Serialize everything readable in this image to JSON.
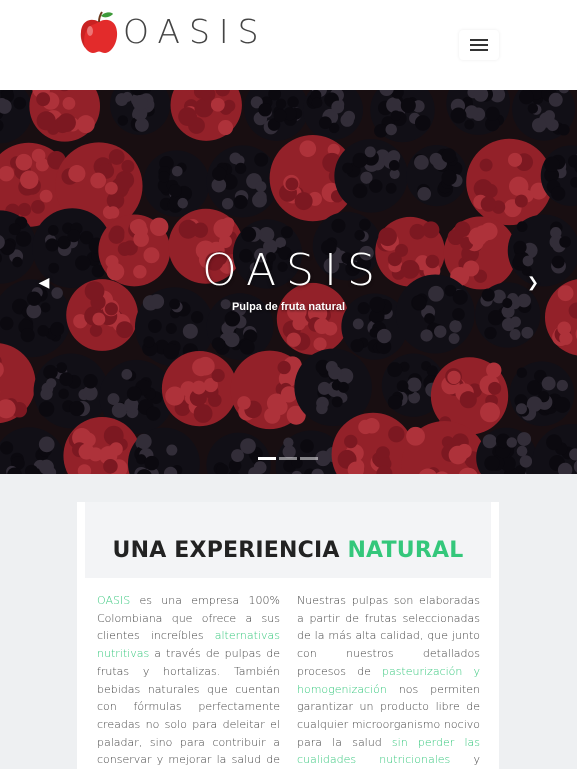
{
  "header": {
    "brand": "OASIS",
    "menu_icon": "hamburger-menu-icon"
  },
  "hero": {
    "title": "OASIS",
    "subtitle": "Pulpa de fruta natural",
    "prev_icon": "chevron-left-icon",
    "next_icon": "chevron-right-icon",
    "slides": 3,
    "active_slide": 1
  },
  "section": {
    "title_main": "UNA EXPERIENCIA ",
    "title_accent": "NATURAL",
    "col1": {
      "p1": "OASIS",
      "p2": " es una empresa 100% Colombiana que ofrece a sus clientes increíbles ",
      "p3": "alternativas nutritivas",
      "p4": " a través de pulpas de frutas y hortalizas. También bebidas naturales que cuentan con fórmulas perfectamente creadas no solo para deleitar el paladar, sino para contribuir a conservar y mejorar la salud de los consumidores."
    },
    "col2": {
      "p1": "Nuestras pulpas son elaboradas a partir de frutas seleccionadas de la más alta calidad, que junto con nuestros detallados procesos de ",
      "p2": "pasteurización y homogenización",
      "p3": " nos permiten garantizar un producto libre de cualquier microorganismo nocivo para la salud ",
      "p4": "sin perder las cualidades nutricionales",
      "p5": " y características saludables propias de"
    }
  },
  "colors": {
    "accent": "#34c77b",
    "apple": "#e32b2b"
  }
}
